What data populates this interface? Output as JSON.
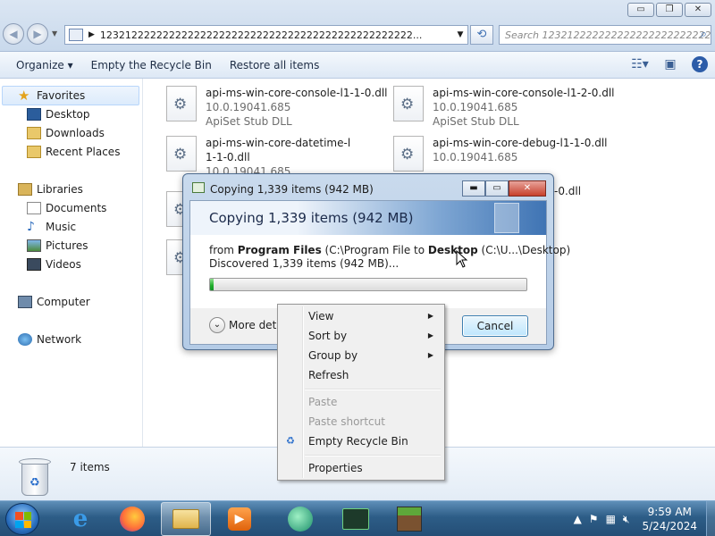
{
  "window": {
    "buttons": {
      "minimize": "▭",
      "maximize": "❐",
      "close": "✕"
    }
  },
  "address": {
    "path": "12321222222222222222222222222222222222222222222222...",
    "search_placeholder": "Search 123212222222222222222222222222..."
  },
  "commands": {
    "organize": "Organize ▾",
    "empty_bin": "Empty the Recycle Bin",
    "restore_all": "Restore all items"
  },
  "nav": {
    "favorites": "Favorites",
    "desktop": "Desktop",
    "downloads": "Downloads",
    "recent_places": "Recent Places",
    "libraries": "Libraries",
    "documents": "Documents",
    "music": "Music",
    "pictures": "Pictures",
    "videos": "Videos",
    "computer": "Computer",
    "network": "Network"
  },
  "files": [
    {
      "name": "api-ms-win-core-console-l1-1-0.dll",
      "version": "10.0.19041.685",
      "type": "ApiSet Stub DLL"
    },
    {
      "name": "api-ms-win-core-console-l1-2-0.dll",
      "version": "10.0.19041.685",
      "type": "ApiSet Stub DLL"
    },
    {
      "name": "api-ms-win-core-datetime-l1-1-0.dll",
      "version": "10.0.19041.685",
      "type": ""
    },
    {
      "name": "api-ms-win-core-debug-l1-1-0.dll",
      "version": "10.0.19041.685",
      "type": ""
    },
    {
      "name": "-0.dll",
      "version": "",
      "type": ""
    }
  ],
  "details": {
    "count": "7 items"
  },
  "copy_dialog": {
    "title": "Copying 1,339 items (942 MB)",
    "heading": "Copying 1,339 items (942 MB)",
    "from_label": "from",
    "from_name": "Program Files",
    "from_path": "(C:\\Program File",
    "to_label": "to",
    "to_name": "Desktop",
    "to_path": "(C:\\U...\\Desktop)",
    "discovered": "Discovered 1,339 items (942 MB)...",
    "progress_fraction": 0.01,
    "more_details": "More deta",
    "cancel": "Cancel"
  },
  "context_menu": {
    "view": "View",
    "sort_by": "Sort by",
    "group_by": "Group by",
    "refresh": "Refresh",
    "paste": "Paste",
    "paste_shortcut": "Paste shortcut",
    "empty_bin": "Empty Recycle Bin",
    "properties": "Properties"
  },
  "taskbar": {
    "time": "9:59 AM",
    "date": "5/24/2024"
  }
}
